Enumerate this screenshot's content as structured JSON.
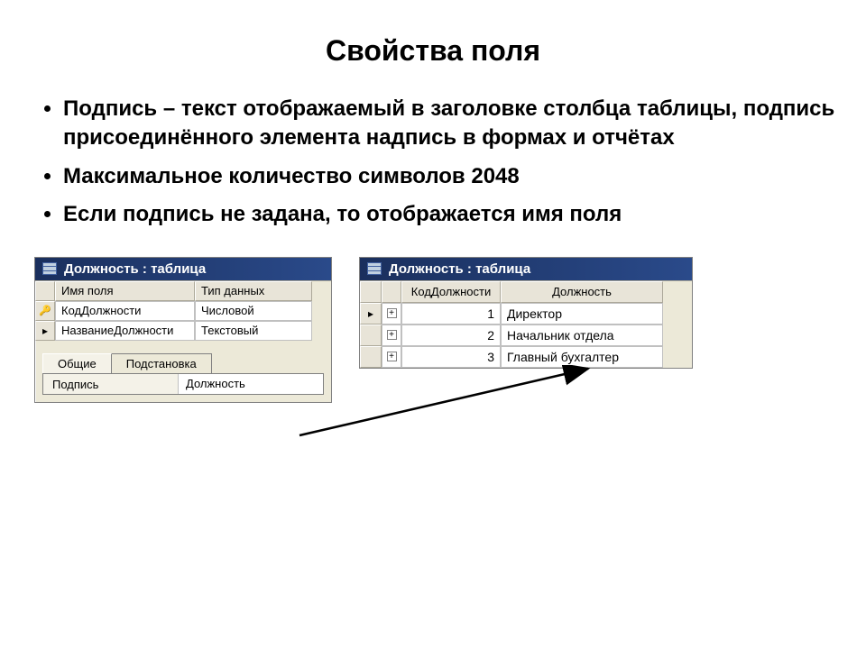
{
  "title": "Свойства поля",
  "bullets": [
    "Подпись – текст отображаемый в заголовке столбца таблицы, подпись присоединённого элемента надпись в формах и отчётах",
    "Максимальное количество символов 2048",
    "Если подпись не задана, то отображается имя поля"
  ],
  "left_window": {
    "title": "Должность : таблица",
    "headers": {
      "name": "Имя поля",
      "type": "Тип данных"
    },
    "rows": [
      {
        "icon": "key",
        "name": "КодДолжности",
        "type": "Числовой"
      },
      {
        "icon": "ptr",
        "name": "НазваниеДолжности",
        "type": "Текстовый"
      }
    ],
    "tabs": {
      "general": "Общие",
      "lookup": "Подстановка"
    },
    "prop": {
      "label": "Подпись",
      "value": "Должность"
    }
  },
  "right_window": {
    "title": "Должность : таблица",
    "headers": {
      "id": "КодДолжности",
      "pos": "Должность"
    },
    "rows": [
      {
        "id": "1",
        "pos": "Директор",
        "current": true
      },
      {
        "id": "2",
        "pos": "Начальник отдела",
        "current": false
      },
      {
        "id": "3",
        "pos": "Главный бухгалтер",
        "current": false
      }
    ]
  }
}
